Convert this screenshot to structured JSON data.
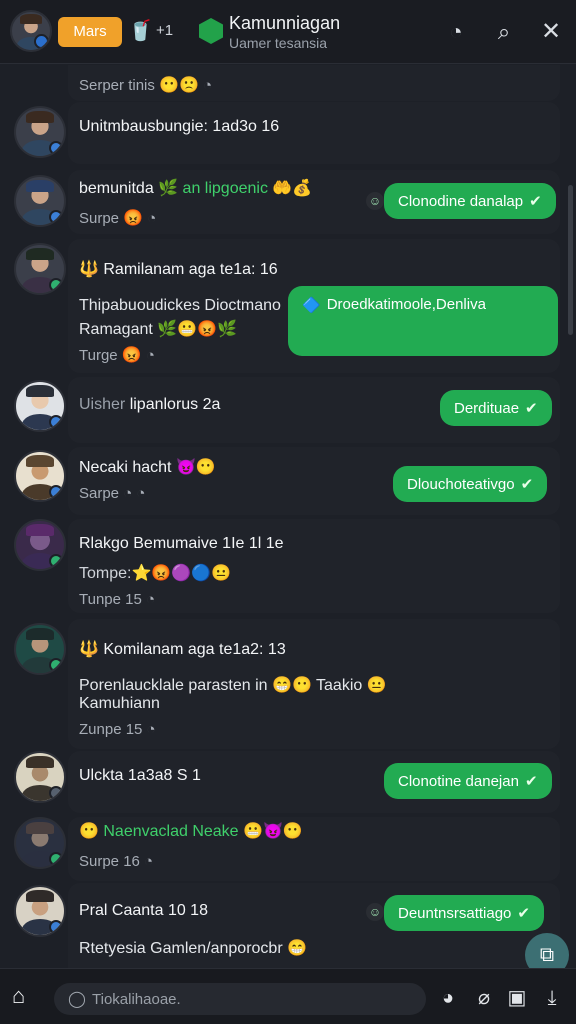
{
  "header": {
    "mars_label": "Mars",
    "count": "+1",
    "title": "Kamunniagan",
    "subtitle": "Uamer tesansia"
  },
  "messages": [
    {
      "meta": "Serper tinis",
      "emojis": "😶🙁"
    },
    {
      "name": "Unitmbausbungie: 1ad3o 16"
    },
    {
      "name": "bemunitda",
      "emojis1": "🌿",
      "name2": "an lipgoenic",
      "emojis2": "🤲💰",
      "meta": "Surpe",
      "meta_emoji": "😡",
      "bubble": "Clonodine danalap"
    },
    {
      "name": "Ramilanam aga te1a: 16",
      "text1": "Thipabuoudickes Dioctmano",
      "text2": "Ramagant",
      "emojis": "🌿😬😡🌿",
      "meta": "Turge",
      "meta_emoji": "😡",
      "bubble": "Droedkatimoole,Denliva"
    },
    {
      "name": "Uisher",
      "name2": "lipanlorus 2a",
      "bubble": "Derdituae"
    },
    {
      "name": "Necaki hacht",
      "emojis": "😈😶",
      "meta": "Sarpe",
      "bubble": "Dlouchoteativgo"
    },
    {
      "name": "Rlakgo Bemumaive 1Ie 1l 1e",
      "text1": "Tompe:",
      "emojis": "⭐😡🟣🔵😐",
      "meta": "Tunpe 15"
    },
    {
      "name": "Komilanam aga te1a2: 13",
      "text1": "Porenlaucklale parasten in",
      "emojis": "😁😶",
      "text2": "Taakio",
      "text3": "Kamuhiann",
      "meta": "Zunpe 15"
    },
    {
      "name": "Ulckta 1a3a8 S 1",
      "bubble": "Clonotine danejan"
    },
    {
      "name": "Naenvaclad Neake",
      "emojis": "😬😈😶",
      "meta": "Surpe 16"
    },
    {
      "name": "Pral Caanta 10 18",
      "text1": "Rtetyesia Gamlen/anporocbr",
      "bubble": "Deuntnsrsattiago"
    }
  ],
  "composer": {
    "placeholder": "Tiokalihaoae."
  },
  "colors": {
    "accent": "#22ab52",
    "mars": "#f0a12a",
    "background": "#1d2027"
  },
  "icons": [
    "search-icon",
    "close-icon",
    "home-icon",
    "attach-icon",
    "check-icon"
  ]
}
